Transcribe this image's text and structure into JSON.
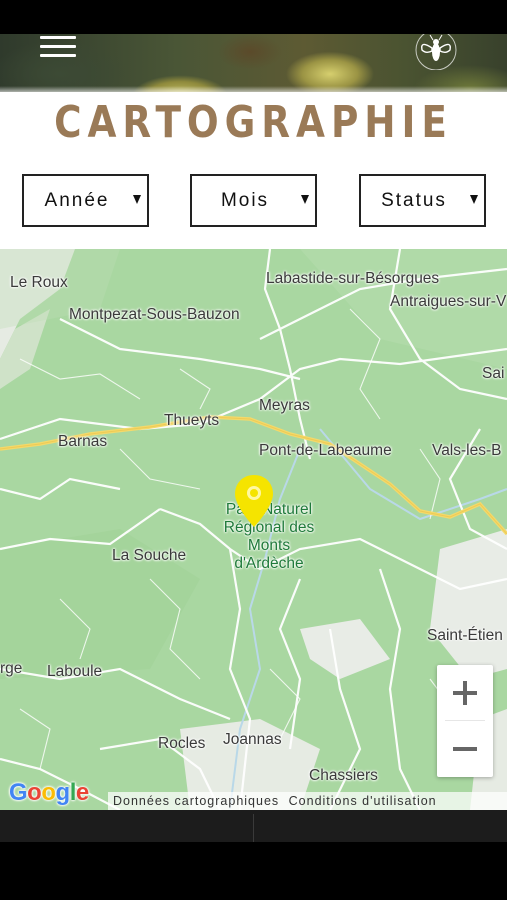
{
  "header": {
    "menu_icon": "hamburger-menu-icon",
    "logo_icon": "bee-logo-icon"
  },
  "page": {
    "title": "CARTOGRAPHIE"
  },
  "filters": [
    {
      "label": "Année"
    },
    {
      "label": "Mois"
    },
    {
      "label": "Status"
    }
  ],
  "map": {
    "places": [
      "Le Roux",
      "Labastide-sur-Bésorgues",
      "Antraigues-sur-V",
      "Montpezat-Sous-Bauzon",
      "Sai",
      "Meyras",
      "Thueyts",
      "Barnas",
      "Pont-de-Labeaume",
      "Vals-les-B",
      "La Souche",
      "Saint-Étien",
      "rge",
      "Laboule",
      "Rocles",
      "Joannas",
      "Chassiers"
    ],
    "park_label": "Parc Naturel Régional des Monts d'Ardèche",
    "marker_icon": "map-pin-icon",
    "marker_color": "#f5e400",
    "zoom_in_icon": "plus-icon",
    "zoom_out_icon": "minus-icon",
    "provider_logo": "Google",
    "attribution": {
      "map_data": "Données cartographiques",
      "terms": "Conditions d'utilisation"
    }
  },
  "colors": {
    "title": "#9a7a57",
    "map_green": "#a8d6a0",
    "road_yellow": "#f4d96a"
  }
}
